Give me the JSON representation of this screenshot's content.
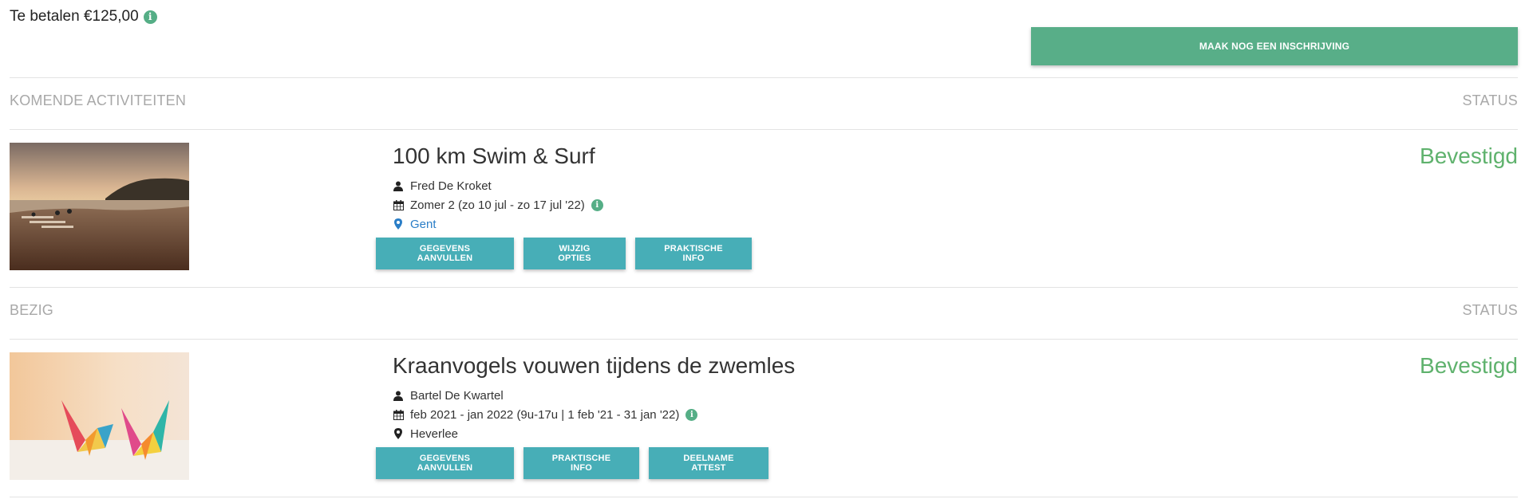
{
  "payment": {
    "label": "Te betalen €125,00",
    "info_icon": "info-circle-icon"
  },
  "actions": {
    "new_registration": "MAAK NOG EEN INSCHRIJVING"
  },
  "colors": {
    "accent_green": "#58ae88",
    "button_teal": "#47aeb7",
    "status_green": "#5fb26d",
    "link_blue": "#2a7ec7"
  },
  "sections": [
    {
      "header": "KOMENDE ACTIVITEITEN",
      "status_header": "STATUS",
      "activity": {
        "title": "100 km Swim & Surf",
        "person": "Fred De Kroket",
        "period": "Zomer 2 (zo 10 jul - zo 17 jul '22)",
        "location": "Gent",
        "status": "Bevestigd",
        "buttons": [
          "GEGEVENS AANVULLEN",
          "WIJZIG OPTIES",
          "PRAKTISCHE INFO"
        ]
      }
    },
    {
      "header": "BEZIG",
      "status_header": "STATUS",
      "activity": {
        "title": "Kraanvogels vouwen tijdens de zwemles",
        "person": "Bartel De Kwartel",
        "period": "feb 2021 - jan 2022 (9u-17u | 1 feb '21 - 31 jan '22)",
        "location": "Heverlee",
        "status": "Bevestigd",
        "buttons": [
          "GEGEVENS AANVULLEN",
          "PRAKTISCHE INFO",
          "DEELNAME ATTEST"
        ]
      }
    }
  ]
}
